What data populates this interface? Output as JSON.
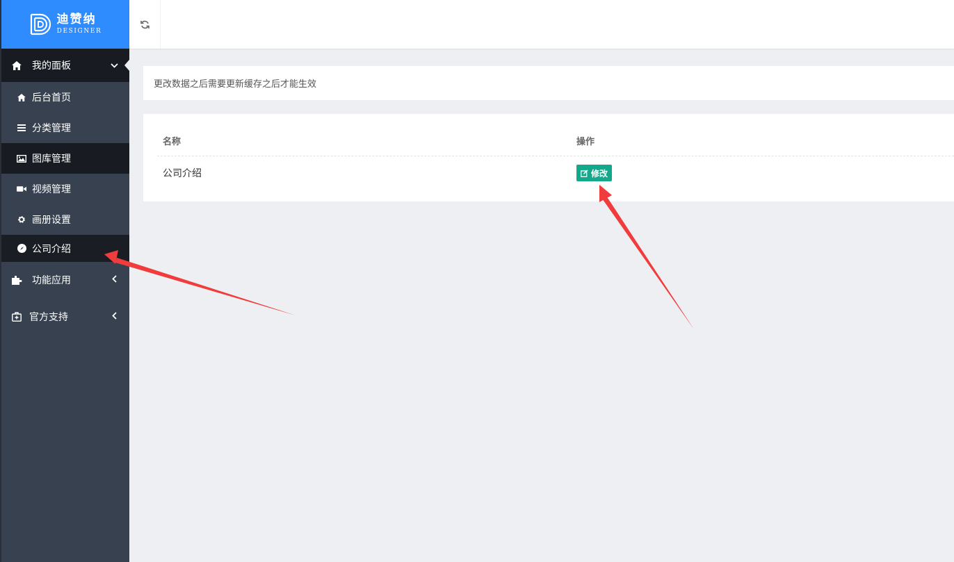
{
  "brand": {
    "name_cn": "迪赞纳",
    "name_en": "DESIGNER",
    "color": "#2f8cff"
  },
  "sidebar": {
    "head": {
      "label": "我的面板",
      "icon": "home-icon"
    },
    "items": [
      {
        "label": "后台首页",
        "icon": "home-icon"
      },
      {
        "label": "分类管理",
        "icon": "list-icon"
      },
      {
        "label": "图库管理",
        "icon": "image-icon"
      },
      {
        "label": "视频管理",
        "icon": "video-icon"
      },
      {
        "label": "画册设置",
        "icon": "gear-icon"
      },
      {
        "label": "公司介绍",
        "icon": "compass-icon"
      }
    ],
    "groups": [
      {
        "label": "功能应用",
        "icon": "puzzle-icon"
      },
      {
        "label": "官方支持",
        "icon": "medkit-icon"
      }
    ]
  },
  "topbar": {
    "refresh_icon": "refresh-icon"
  },
  "notice": {
    "text": "更改数据之后需要更新缓存之后才能生效"
  },
  "table": {
    "headers": [
      "名称",
      "操作"
    ],
    "rows": [
      {
        "name": "公司介绍",
        "action_label": "修改"
      }
    ]
  },
  "colors": {
    "sidebar_bg": "#37414f",
    "sidebar_active": "#181c22",
    "edit_button": "#13a889",
    "annotation": "#f03c3c"
  }
}
